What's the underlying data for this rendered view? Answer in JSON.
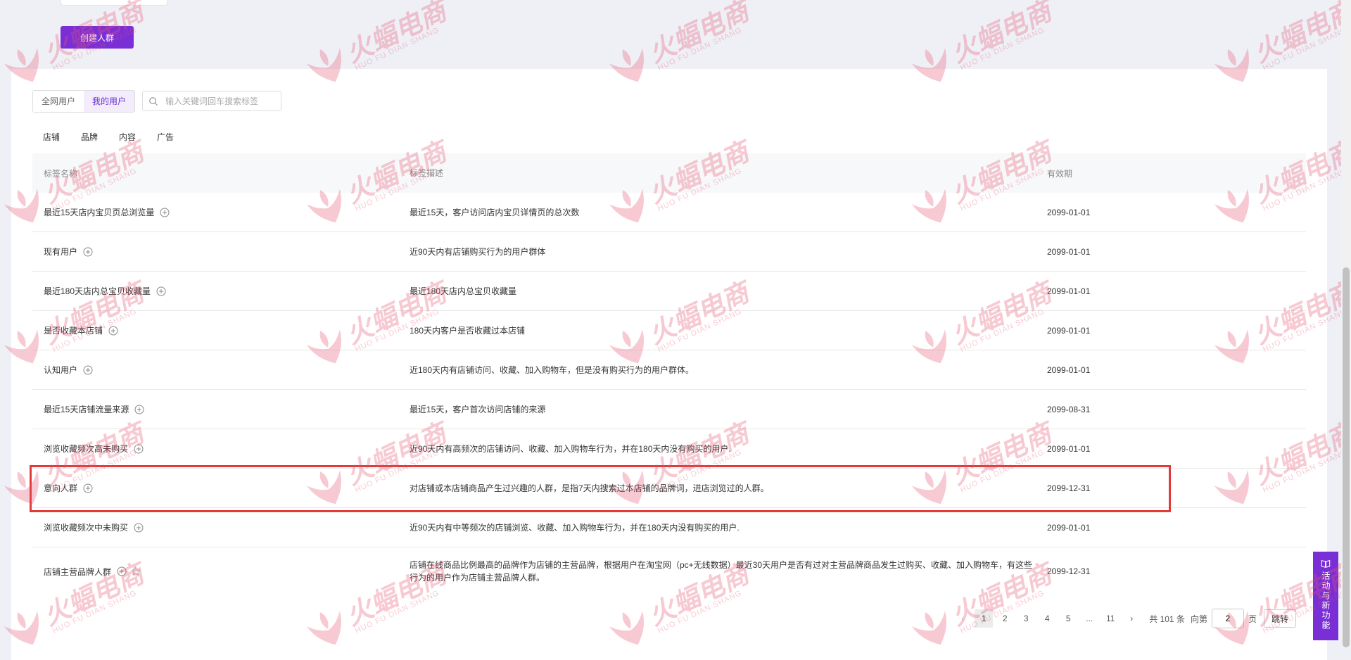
{
  "create_button_label": "创建人群",
  "user_tabs": [
    {
      "label": "全网用户",
      "active": false
    },
    {
      "label": "我的用户",
      "active": true
    }
  ],
  "search": {
    "placeholder": "输入关键词回车搜索标签"
  },
  "category_tabs": [
    "店铺",
    "品牌",
    "内容",
    "广告"
  ],
  "table": {
    "headers": {
      "name": "标签名称",
      "desc": "标签描述",
      "validity": "有效期"
    },
    "rows": [
      {
        "name": "最近15天店内宝贝页总浏览量",
        "desc": "最近15天，客户访问店内宝贝详情页的总次数",
        "validity": "2099-01-01"
      },
      {
        "name": "现有用户",
        "desc": "近90天内有店铺购买行为的用户群体",
        "validity": "2099-01-01"
      },
      {
        "name": "最近180天店内总宝贝收藏量",
        "desc": "最近180天店内总宝贝收藏量",
        "validity": "2099-01-01"
      },
      {
        "name": "是否收藏本店铺",
        "desc": "180天内客户是否收藏过本店铺",
        "validity": "2099-01-01"
      },
      {
        "name": "认知用户",
        "desc": "近180天内有店铺访问、收藏、加入购物车，但是没有购买行为的用户群体。",
        "validity": "2099-01-01"
      },
      {
        "name": "最近15天店铺流量来源",
        "desc": "最近15天，客户首次访问店铺的来源",
        "validity": "2099-08-31"
      },
      {
        "name": "浏览收藏频次高未购买",
        "desc": "近90天内有高频次的店铺访问、收藏、加入购物车行为，并在180天内没有购买的用户.",
        "validity": "2099-01-01"
      },
      {
        "name": "意向人群",
        "desc": "对店铺或本店铺商品产生过兴趣的人群，是指7天内搜索过本店铺的品牌词，进店浏览过的人群。",
        "validity": "2099-12-31"
      },
      {
        "name": "浏览收藏频次中未购买",
        "desc": "近90天内有中等频次的店铺浏览、收藏、加入购物车行为，并在180天内没有购买的用户.",
        "validity": "2099-01-01"
      },
      {
        "name": "店铺主营品牌人群",
        "desc": "店铺在线商品比例最高的品牌作为店铺的主营品牌，根据用户在淘宝网（pc+无线数据）最近30天用户是否有过对主营品牌商品发生过购买、收藏、加入购物车，有这些行为的用户作为店铺主营品牌人群。",
        "validity": "2099-12-31"
      }
    ]
  },
  "pagination": {
    "pages": [
      "1",
      "2",
      "3",
      "4",
      "5",
      "...",
      "11"
    ],
    "current": "1",
    "total_text": "共 101 条",
    "goto_prefix": "向第",
    "goto_value": "2",
    "goto_suffix": "页",
    "jump_label": "跳转"
  },
  "side_float_label": "活动与新功能",
  "watermark": {
    "brand": "火蝠电商",
    "sub": "HUO FU DIAN SHANG"
  },
  "colors": {
    "accent": "#7a2fd6",
    "highlight": "#e23a3a",
    "watermark": "#e8536f"
  }
}
